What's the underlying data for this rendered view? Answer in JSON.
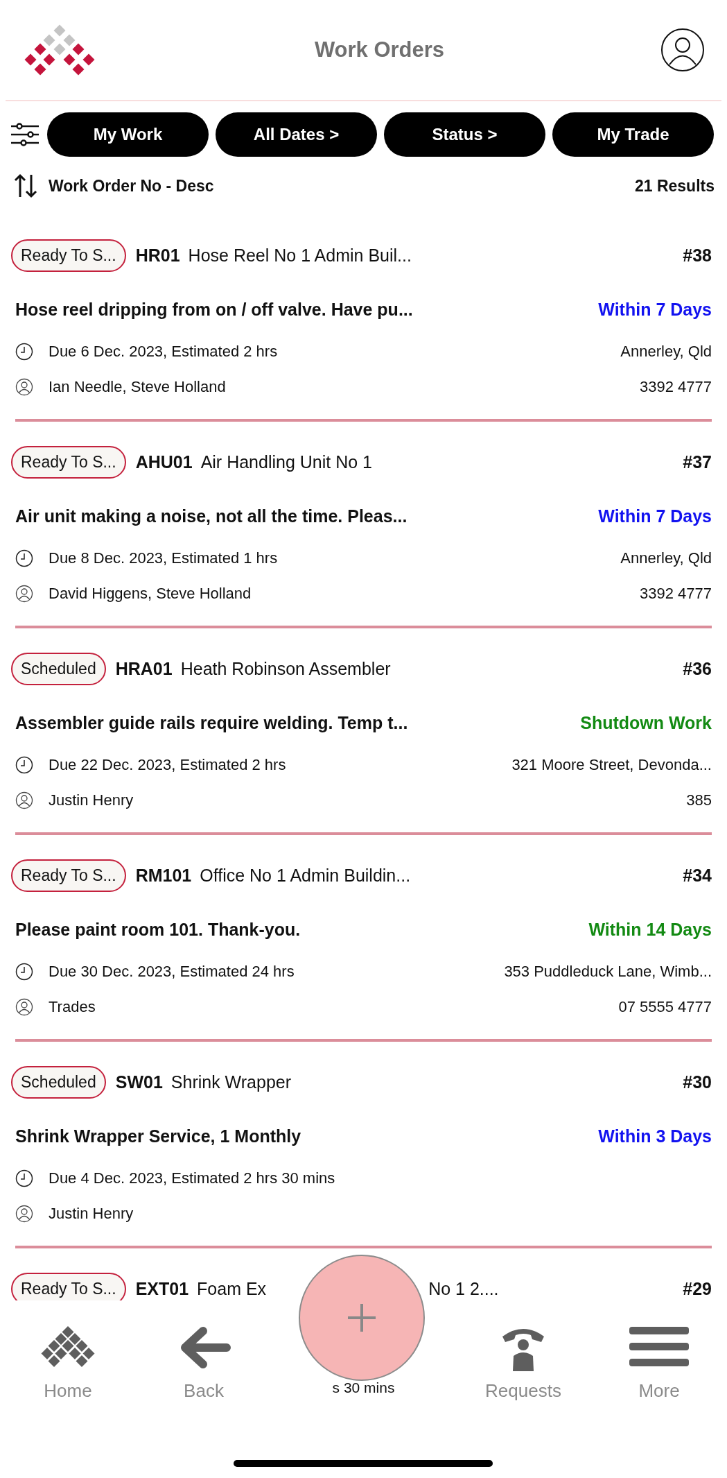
{
  "header": {
    "title": "Work Orders"
  },
  "filters": [
    "My Work",
    "All Dates >",
    "Status >",
    "My Trade"
  ],
  "sort": {
    "label": "Work Order No - Desc",
    "results": "21 Results"
  },
  "orders": [
    {
      "status": "Ready To S...",
      "asset_code": "HR01",
      "asset_name": "Hose Reel No 1 Admin Buil...",
      "number": "#38",
      "title": "Hose reel dripping from on / off valve.  Have pu...",
      "priority": "Within 7 Days",
      "color": "#1212f0",
      "due": "Due 6 Dec. 2023, Estimated 2 hrs",
      "people": "Ian Needle, Steve Holland",
      "location": "Annerley, Qld",
      "phone": "3392 4777"
    },
    {
      "status": "Ready To S...",
      "asset_code": "AHU01",
      "asset_name": "Air Handling Unit No 1",
      "number": "#37",
      "title": "Air unit making a noise, not all the time.  Pleas...",
      "priority": "Within 7 Days",
      "color": "#1212f0",
      "due": "Due 8 Dec. 2023, Estimated 1 hrs",
      "people": "David Higgens, Steve Holland",
      "location": "Annerley, Qld",
      "phone": "3392 4777"
    },
    {
      "status": "Scheduled",
      "asset_code": "HRA01",
      "asset_name": "Heath Robinson Assembler",
      "number": "#36",
      "title": "Assembler guide rails require welding.  Temp t...",
      "priority": "Shutdown Work",
      "color": "#138a13",
      "due": "Due 22 Dec. 2023, Estimated 2 hrs",
      "people": "Justin Henry",
      "location": "321 Moore Street, Devonda...",
      "phone": "385"
    },
    {
      "status": "Ready To S...",
      "asset_code": "RM101",
      "asset_name": "Office No 1 Admin Buildin...",
      "number": "#34",
      "title": "Please paint room 101.  Thank-you.",
      "priority": "Within 14 Days",
      "color": "#138a13",
      "due": "Due 30 Dec. 2023, Estimated 24 hrs",
      "people": "Trades",
      "location": "353 Puddleduck Lane, Wimb...",
      "phone": "07 5555 4777"
    },
    {
      "status": "Scheduled",
      "asset_code": "SW01",
      "asset_name": "Shrink Wrapper",
      "number": "#30",
      "title": "Shrink Wrapper Service, 1 Monthly",
      "priority": "Within 3 Days",
      "color": "#1212f0",
      "due": "Due 4 Dec. 2023, Estimated 2 hrs 30 mins",
      "people": "Justin Henry"
    }
  ],
  "partial_order": {
    "status": "Ready To S...",
    "asset_code": "EXT01",
    "asset_name_parts": [
      "Foam Ex",
      "No 1 2...."
    ],
    "number": "#29",
    "peek_text": "s 30 mins"
  },
  "nav": [
    {
      "kind": "home",
      "label": "Home"
    },
    {
      "kind": "back",
      "label": "Back"
    },
    {
      "kind": "requests",
      "label": "Requests"
    },
    {
      "kind": "more",
      "label": "More"
    }
  ]
}
